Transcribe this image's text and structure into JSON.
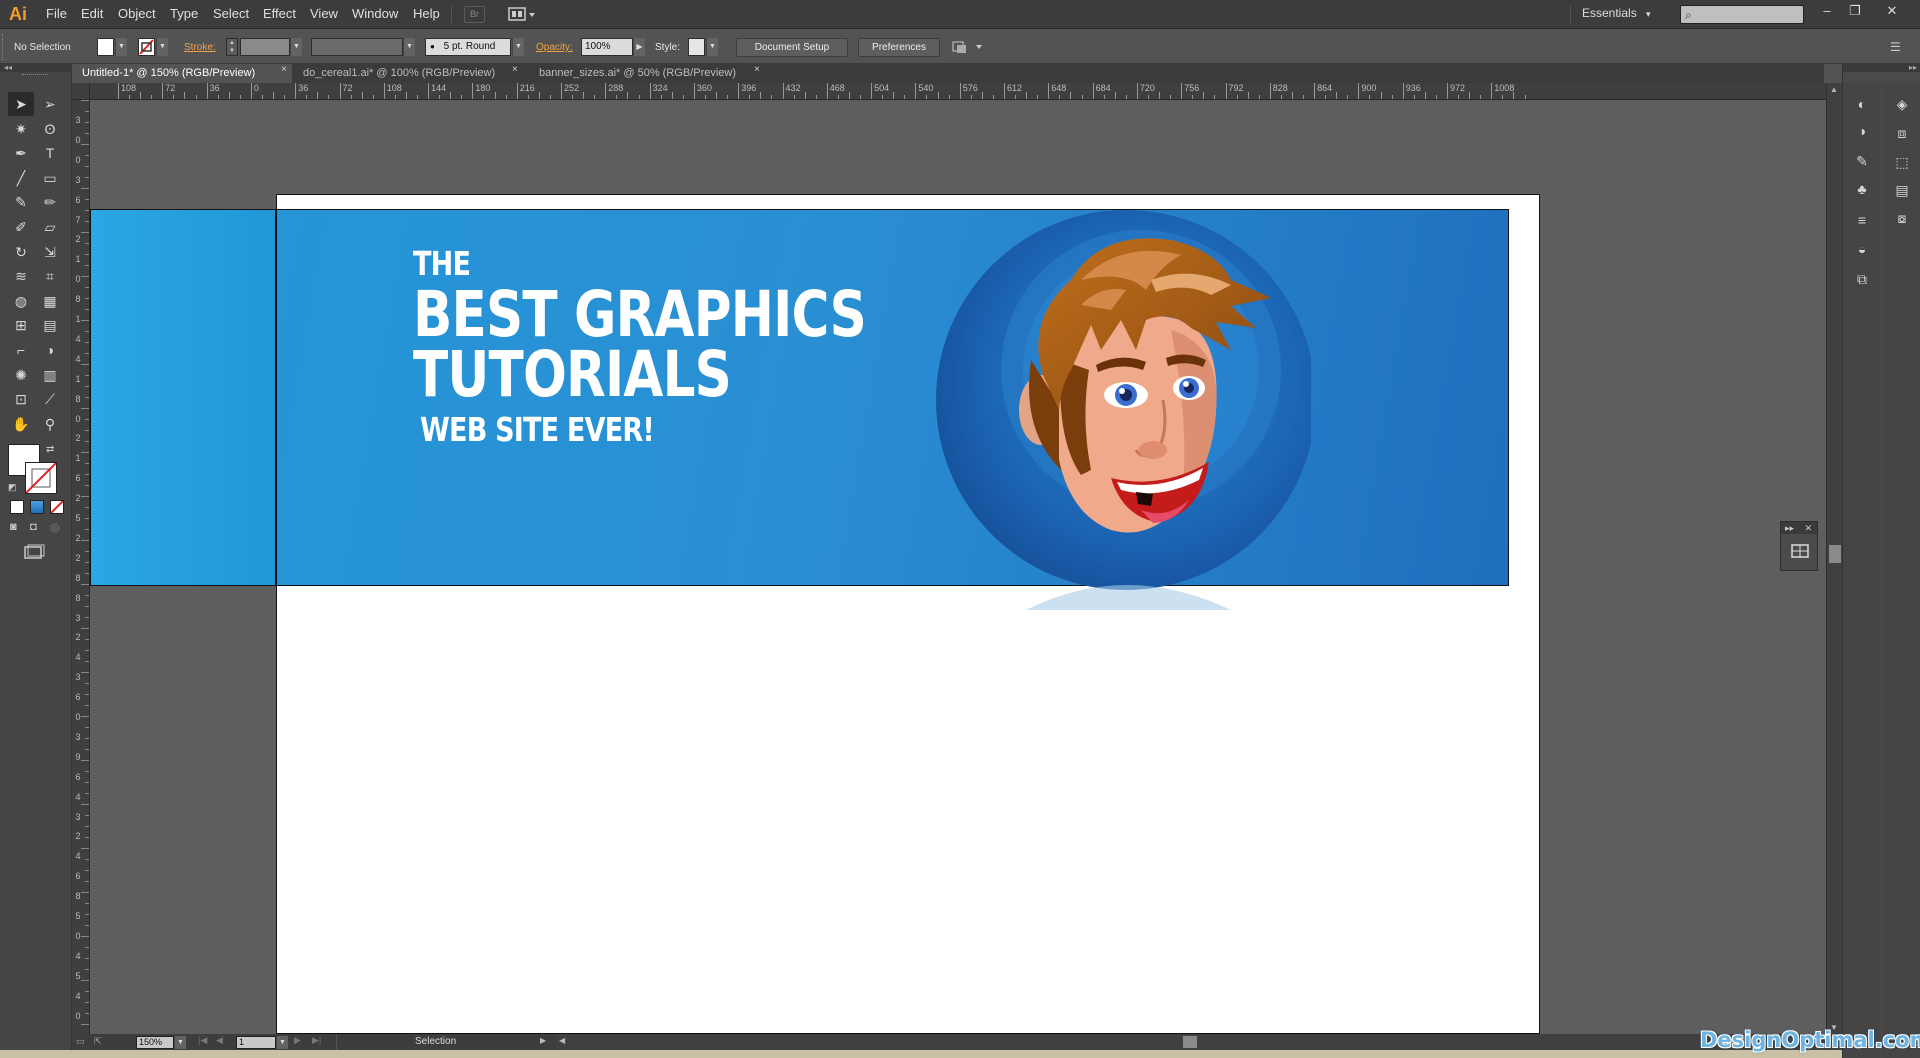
{
  "app": {
    "logo": "Ai"
  },
  "menu": [
    "File",
    "Edit",
    "Object",
    "Type",
    "Select",
    "Effect",
    "View",
    "Window",
    "Help"
  ],
  "bridge_label": "Br",
  "workspace": {
    "label": "Essentials",
    "arrow": "▾"
  },
  "window_controls": {
    "minimize": "–",
    "restore": "❐",
    "close": "✕"
  },
  "control_bar": {
    "selection_status": "No Selection",
    "stroke_label": "Stroke:",
    "brush_label": "5 pt. Round",
    "opacity_label": "Opacity:",
    "opacity_value": "100%",
    "style_label": "Style:",
    "document_setup": "Document Setup",
    "preferences": "Preferences"
  },
  "tabs": [
    {
      "label": "Untitled-1* @ 150% (RGB/Preview)",
      "active": true
    },
    {
      "label": "do_cereal1.ai* @ 100% (RGB/Preview)",
      "active": false
    },
    {
      "label": "banner_sizes.ai* @ 50% (RGB/Preview)",
      "active": false
    }
  ],
  "tab_close": "×",
  "ruler": {
    "horizontal": [
      "108",
      "72",
      "36",
      "0",
      "36",
      "72",
      "108",
      "144",
      "180",
      "216",
      "252",
      "288",
      "324",
      "360",
      "396",
      "432",
      "468",
      "504",
      "540",
      "576",
      "612",
      "648",
      "684",
      "720",
      "756",
      "792",
      "828",
      "864",
      "900",
      "936",
      "972",
      "1008"
    ],
    "vertical": [
      "3",
      "0",
      "0",
      "3",
      "6",
      "7",
      "2",
      "1",
      "0",
      "8",
      "1",
      "4",
      "4",
      "1",
      "8",
      "0",
      "2",
      "1",
      "6",
      "2",
      "5",
      "2",
      "2",
      "8",
      "8",
      "3",
      "2",
      "4",
      "3",
      "6",
      "0",
      "3",
      "9",
      "6",
      "4",
      "3",
      "2",
      "4",
      "6",
      "8",
      "5",
      "0",
      "4",
      "5",
      "4",
      "0"
    ]
  },
  "banner": {
    "line1": "THE",
    "line2": "BEST GRAPHICS",
    "line3": "TUTORIALS",
    "line4": "WEB SITE EVER!"
  },
  "status_bar": {
    "zoom": "150%",
    "artboard_number": "1",
    "tool_status": "Selection"
  },
  "watermark": "DesignOptimal.com",
  "colors": {
    "banner_blue": "#2595d7",
    "banner_dark": "#1f6fbd",
    "accent_orange": "#f29d2b"
  },
  "icons": {
    "search": "⌕",
    "tools": [
      "selection",
      "direct-selection",
      "magic-wand",
      "lasso",
      "pen",
      "type",
      "line-segment",
      "rectangle",
      "paintbrush",
      "pencil",
      "blob-brush",
      "eraser",
      "rotate",
      "scale",
      "warp",
      "free-transform",
      "shape-builder",
      "perspective-grid",
      "mesh",
      "gradient",
      "eyedropper",
      "blend",
      "symbol-sprayer",
      "column-graph",
      "artboard",
      "slice",
      "hand",
      "zoom"
    ]
  }
}
